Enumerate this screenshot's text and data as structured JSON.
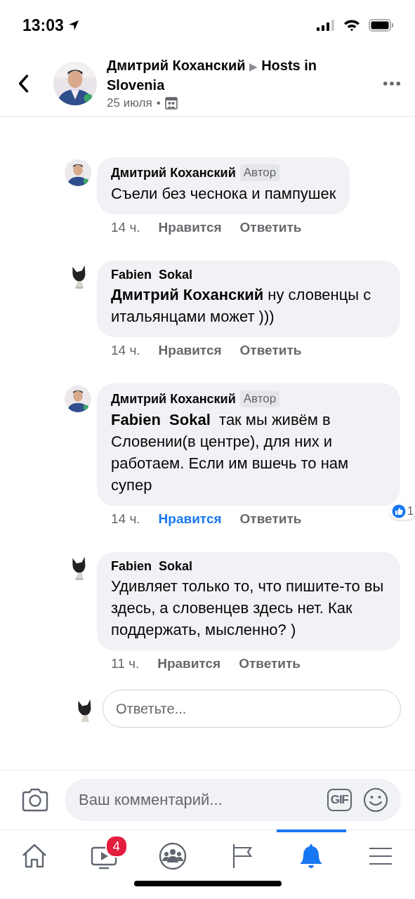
{
  "status_bar": {
    "time": "13:03"
  },
  "header": {
    "author": "Дмитрий Коханский",
    "arrow": "▶",
    "group": "Hosts in Slovenia",
    "date": "25 июля",
    "separator": "•"
  },
  "comments": [
    {
      "author": "Дмитрий Коханский",
      "badge": "Автор",
      "text": "Съели без чеснока и пампушек",
      "time": "14 ч.",
      "like": "Нравится",
      "liked": false,
      "reply": "Ответить"
    },
    {
      "author": "Fabien  Sokal",
      "text": "**Дмитрий Коханский** ну словенцы с итальянцами может )))",
      "time": "14 ч.",
      "like": "Нравится",
      "liked": false,
      "reply": "Ответить"
    },
    {
      "author": "Дмитрий Коханский",
      "badge": "Автор",
      "text": "**Fabien  Sokal**  так мы живём в Словении(в центре), для них и работаем. Если им вшечь то нам супер",
      "time": "14 ч.",
      "like": "Нравится",
      "liked": true,
      "reply": "Ответить",
      "reactions": "1"
    },
    {
      "author": "Fabien  Sokal",
      "text": "Удивляет только то, что пишите-то вы здесь, а словенцев здесь нет. Как поддержать, мысленно? )",
      "time": "11 ч.",
      "like": "Нравится",
      "liked": false,
      "reply": "Ответить"
    }
  ],
  "reply_field": {
    "placeholder": "Ответьте..."
  },
  "composer": {
    "placeholder": "Ваш комментарий...",
    "gif": "GIF"
  },
  "tabs": [
    {
      "kind": "home",
      "selected": false
    },
    {
      "kind": "watch",
      "selected": false,
      "badge": "4"
    },
    {
      "kind": "groups",
      "selected": false
    },
    {
      "kind": "pages",
      "selected": false
    },
    {
      "kind": "notifications",
      "selected": true
    },
    {
      "kind": "menu",
      "selected": false
    }
  ]
}
